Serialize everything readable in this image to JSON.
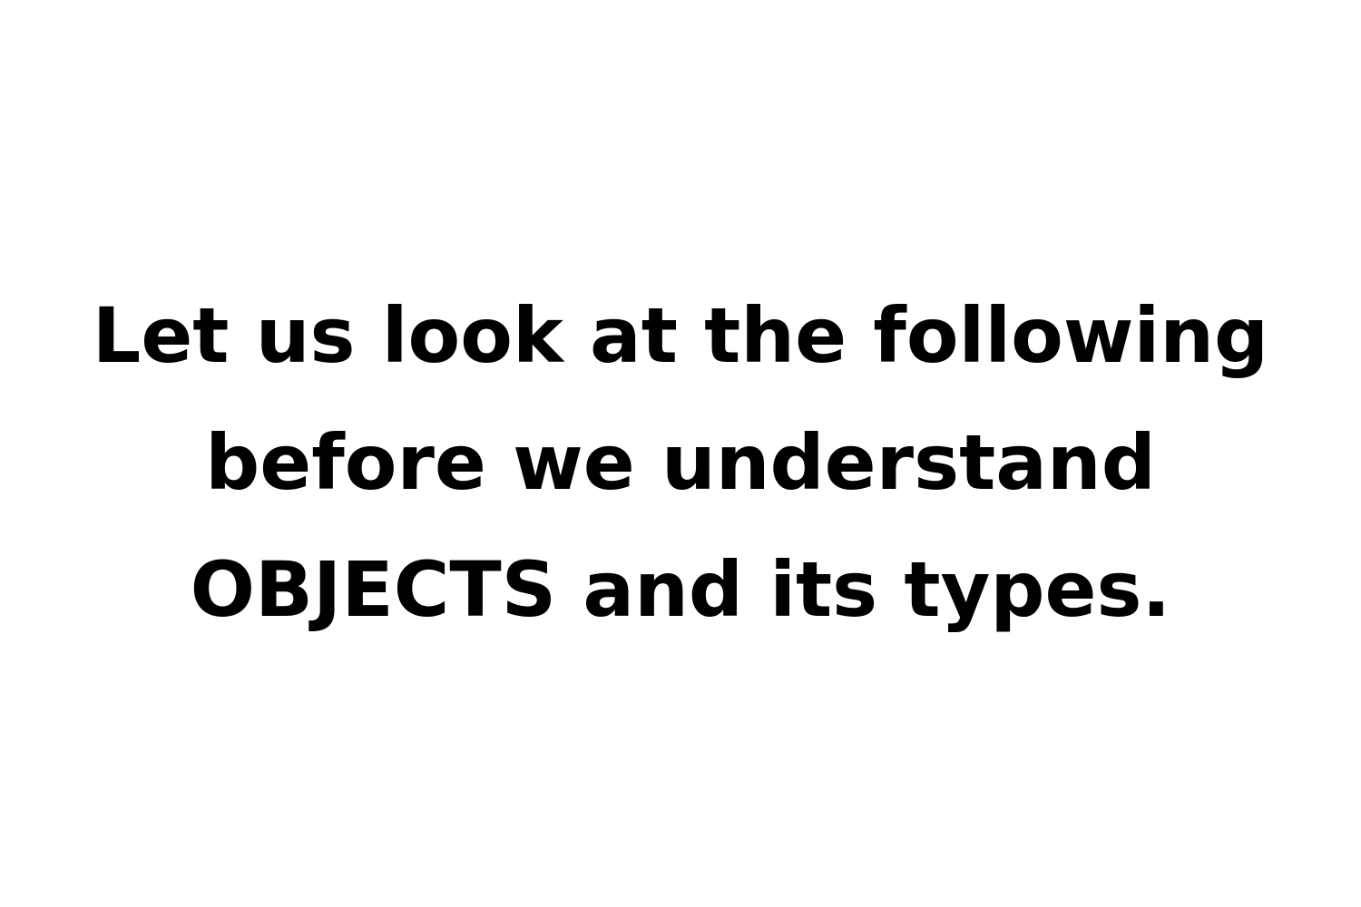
{
  "slide": {
    "lines": [
      "Let us look at the following",
      "before we understand",
      "OBJECTS and its types."
    ],
    "text_color": "#000000",
    "background_color": "#ffffff"
  }
}
